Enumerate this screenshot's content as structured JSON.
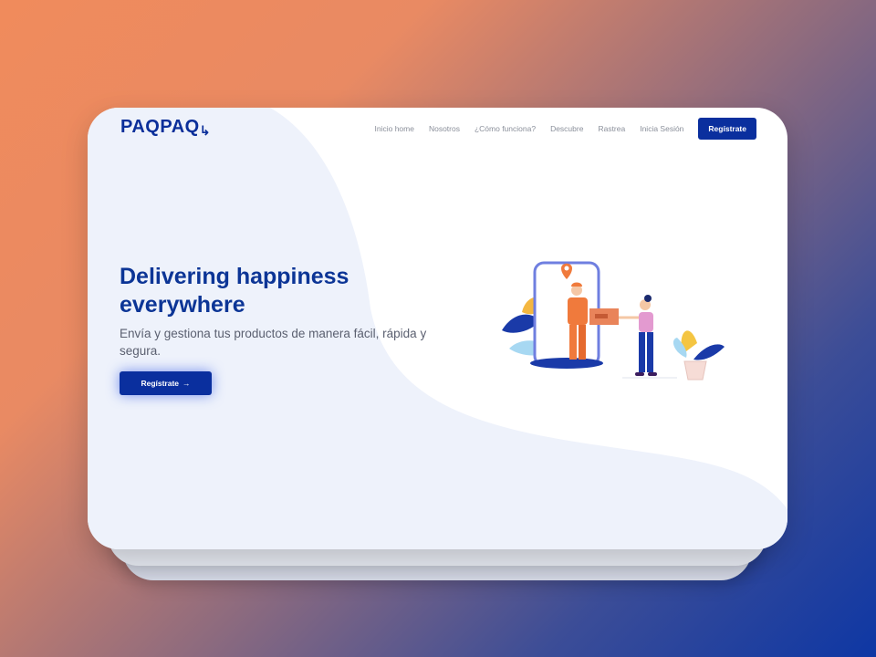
{
  "brand": {
    "logo_text": "PAQPAQ",
    "logo_mark": "↳"
  },
  "nav": {
    "items": [
      "Inicio home",
      "Nosotros",
      "¿Cómo funciona?",
      "Descubre",
      "Rastrea",
      "Inicia Sesión"
    ],
    "cta_label": "Regístrate"
  },
  "hero": {
    "title": "Delivering happiness everywhere",
    "subtitle": "Envía y gestiona tus productos de manera fácil, rápida y segura.",
    "cta_label": "Regístrate",
    "cta_arrow": "→"
  },
  "colors": {
    "brand_blue": "#0a2f9e",
    "accent_orange": "#f07a3c",
    "background_gradient_start": "#f08b5c",
    "background_gradient_end": "#0e37a4"
  },
  "icons": [
    "logo-arrow-icon",
    "arrow-right-icon",
    "map-pin-icon"
  ]
}
